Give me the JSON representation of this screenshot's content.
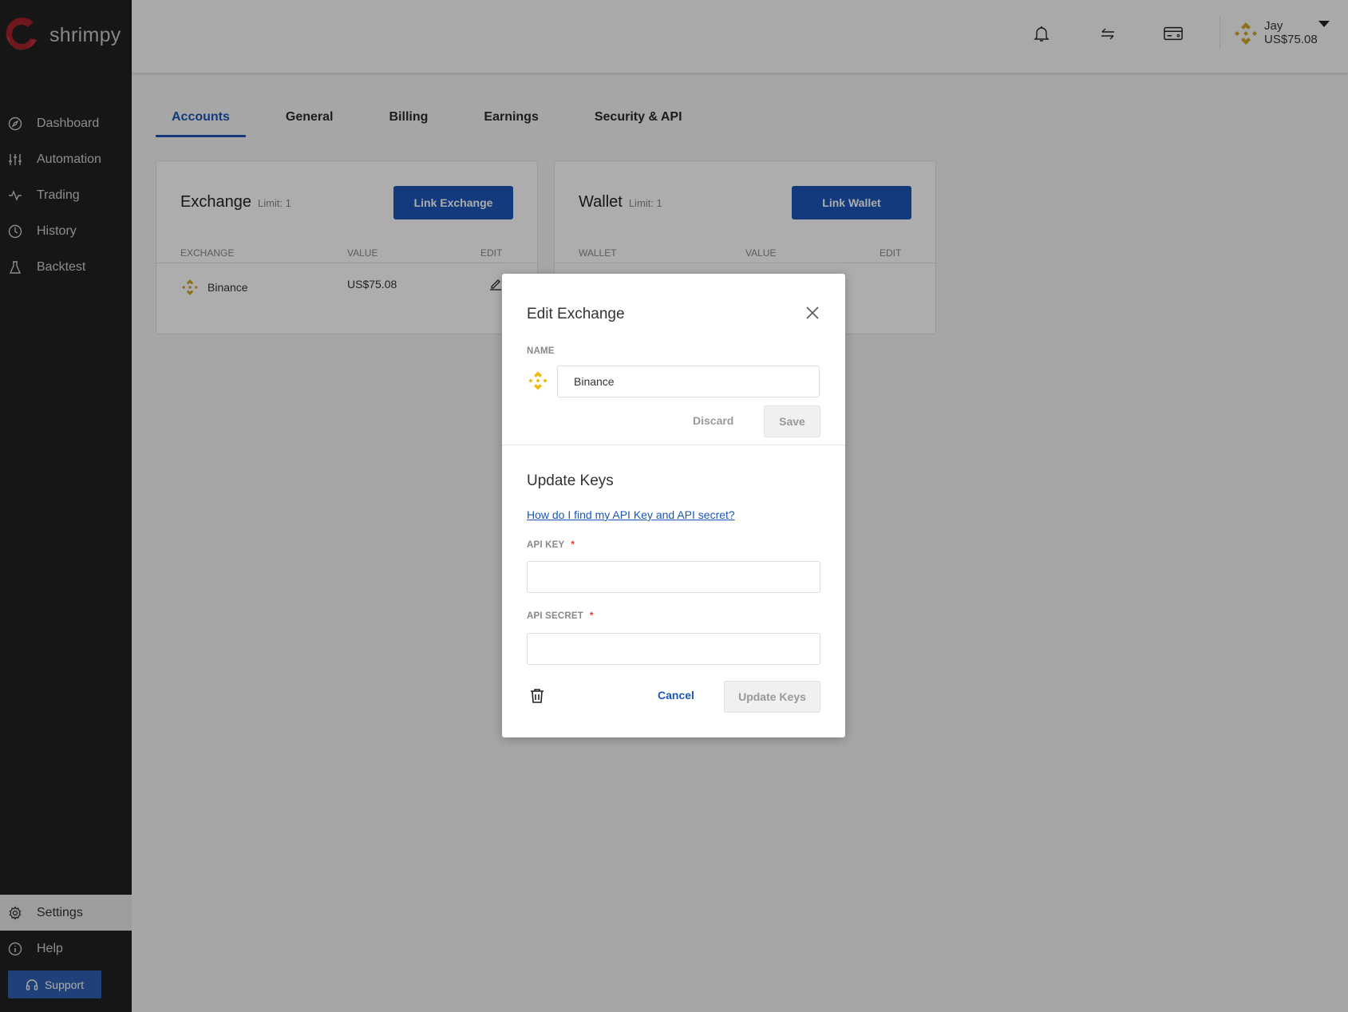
{
  "app": {
    "name": "shrimpy"
  },
  "sidebar": {
    "items": [
      {
        "label": "Dashboard",
        "icon": "compass-icon"
      },
      {
        "label": "Automation",
        "icon": "sliders-icon"
      },
      {
        "label": "Trading",
        "icon": "activity-icon"
      },
      {
        "label": "History",
        "icon": "clock-icon"
      },
      {
        "label": "Backtest",
        "icon": "flask-icon"
      }
    ],
    "bottom_items": [
      {
        "label": "Settings",
        "icon": "gear-icon",
        "active": true
      },
      {
        "label": "Help",
        "icon": "info-icon"
      }
    ],
    "support_label": "Support"
  },
  "topbar": {
    "icons": [
      "bell-icon",
      "transfer-icon",
      "credit-card-icon"
    ],
    "user": {
      "name": "Jay",
      "balance": "US$75.08"
    }
  },
  "tabs": [
    {
      "label": "Accounts",
      "active": true
    },
    {
      "label": "General"
    },
    {
      "label": "Billing"
    },
    {
      "label": "Earnings"
    },
    {
      "label": "Security & API"
    }
  ],
  "exchange_card": {
    "title": "Exchange",
    "limit": "Limit: 1",
    "button": "Link Exchange",
    "columns": [
      "EXCHANGE",
      "VALUE",
      "EDIT"
    ],
    "rows": [
      {
        "name": "Binance",
        "value": "US$75.08"
      }
    ]
  },
  "wallet_card": {
    "title": "Wallet",
    "limit": "Limit: 1",
    "button": "Link Wallet",
    "columns": [
      "WALLET",
      "VALUE",
      "EDIT"
    ]
  },
  "modal": {
    "title": "Edit Exchange",
    "name_label": "NAME",
    "name_value": "Binance",
    "discard_label": "Discard",
    "save_label": "Save",
    "update_title": "Update Keys",
    "help_link": "How do I find my API Key and API secret?",
    "api_key_label": "API KEY",
    "api_key_value": "",
    "api_secret_label": "API SECRET",
    "api_secret_value": "",
    "required_mark": "*",
    "cancel_label": "Cancel",
    "update_label": "Update Keys"
  },
  "colors": {
    "accent": "#1b56b8",
    "binance": "#f0b90b",
    "sidebar": "#212121",
    "logo": "#b3262d"
  }
}
